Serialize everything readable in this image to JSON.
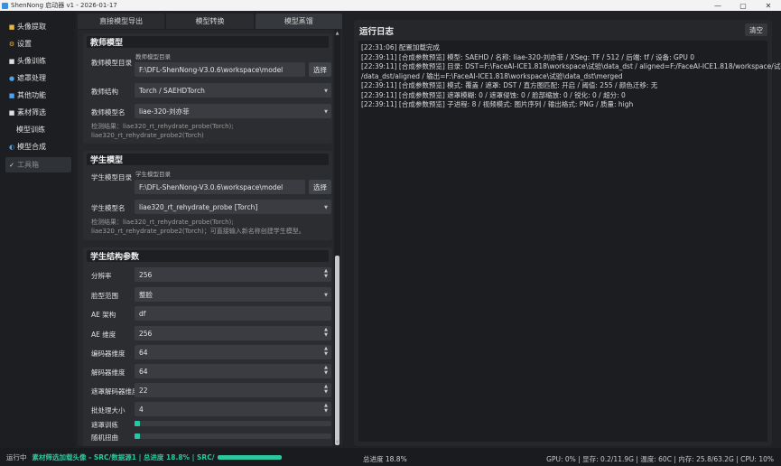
{
  "window": {
    "title": "ShenNong 启动器 v1 - 2026-01-17",
    "min": "—",
    "max": "▢",
    "close": "✕"
  },
  "sidebar": {
    "items": [
      {
        "icon": "■",
        "label": "头像提取"
      },
      {
        "icon": "⚙",
        "label": "设置"
      },
      {
        "icon": "■",
        "label": "头像训练"
      },
      {
        "icon": "●",
        "label": "遮罩处理"
      },
      {
        "icon": "■",
        "label": "其他功能"
      },
      {
        "icon": "■",
        "label": "素材筛选"
      },
      {
        "icon": "",
        "label": "模型训练"
      },
      {
        "icon": "◐",
        "label": "模型合成"
      },
      {
        "icon": "✓",
        "label": "工具箱"
      }
    ]
  },
  "tabs": [
    "直接模型导出",
    "模型转换",
    "模型蒸馏"
  ],
  "teacher": {
    "title": "教师模型",
    "dir_label": "教师模型目录",
    "dir_small": "教师模型目录",
    "dir_value": "F:\\DFL-ShenNong-V3.0.6\\workspace\\model",
    "browse": "选择",
    "arch_label": "教师结构",
    "arch_value": "Torch / SAEHDTorch",
    "name_label": "教师模型名",
    "name_value": "liae-320-刘亦菲",
    "hint_line1": "检测结果：liae320_rt_rehydrate_probe(Torch);",
    "hint_line2": "liae320_rt_rehydrate_probe2(Torch)"
  },
  "student": {
    "title": "学生模型",
    "dir_label": "学生模型目录",
    "dir_small": "学生模型目录",
    "dir_value": "F:\\DFL-ShenNong-V3.0.6\\workspace\\model",
    "browse": "选择",
    "name_label": "学生模型名",
    "name_value": "liae320_rt_rehydrate_probe [Torch]",
    "hint_line1": "检测结果：liae320_rt_rehydrate_probe(Torch);",
    "hint_line2": "liae320_rt_rehydrate_probe2(Torch)；可直接输入新名称创建学生模型。"
  },
  "params": {
    "title": "学生结构参数",
    "resolution_label": "分辨率",
    "resolution_value": "256",
    "face_label": "脸型范围",
    "face_value": "整脸",
    "ae_arch_label": "AE 架构",
    "ae_arch_value": "df",
    "ae_dims_label": "AE 维度",
    "ae_dims_value": "256",
    "enc_label": "编码器维度",
    "enc_value": "64",
    "dec_label": "解码器维度",
    "dec_value": "64",
    "mask_dec_label": "遮罩解码器维度",
    "mask_dec_value": "22",
    "batch_label": "批处理大小",
    "batch_value": "4",
    "mask_train_label": "遮罩训练",
    "random_warp_label": "随机扭曲"
  },
  "log": {
    "title": "运行日志",
    "clear": "清空",
    "lines": [
      "[22:31:06] 配置加载完成",
      "[22:39:11] [合成参数预览] 模型: SAEHD / 名称: liae-320-刘亦菲 / XSeg: TF / 512 / 后端: tf / 设备: GPU 0",
      "[22:39:11] [合成参数预览] 目录: DST=F:\\FaceAI-ICE1.818\\workspace\\试验\\data_dst / aligned=F:/FaceAI-ICE1.818/workspace/试验",
      "/data_dst/aligned / 输出=F:\\FaceAI-ICE1.818\\workspace\\试验\\data_dst\\merged",
      "[22:39:11] [合成参数预览] 模式: 覆盖 / 遮罩: DST / 直方图匹配: 开启 / 阈值: 255 / 颜色迁移: 无",
      "[22:39:11] [合成参数预览] 遮罩模糊: 0 / 遮罩侵蚀: 0 / 脸部缩放: 0 / 锐化: 0 / 超分: 0",
      "[22:39:11] [合成参数预览] 子进程: 8 / 视频模式: 图片序列 / 输出格式: PNG / 质量: high"
    ]
  },
  "status": {
    "running": "运行中",
    "task": "素材筛选加载头像 - SRC/数据源1 | 总进度 18.8% | SRC/",
    "progress": 0.188,
    "total": "总进度 18.8%",
    "system": "GPU: 0% | 显存: 0.2/11.9G | 温度: 60C | 内存: 25.8/63.2G | CPU: 10%"
  },
  "colors": {
    "accent": "#2cc79f",
    "background": "#1f2124",
    "panel": "#25272a"
  }
}
